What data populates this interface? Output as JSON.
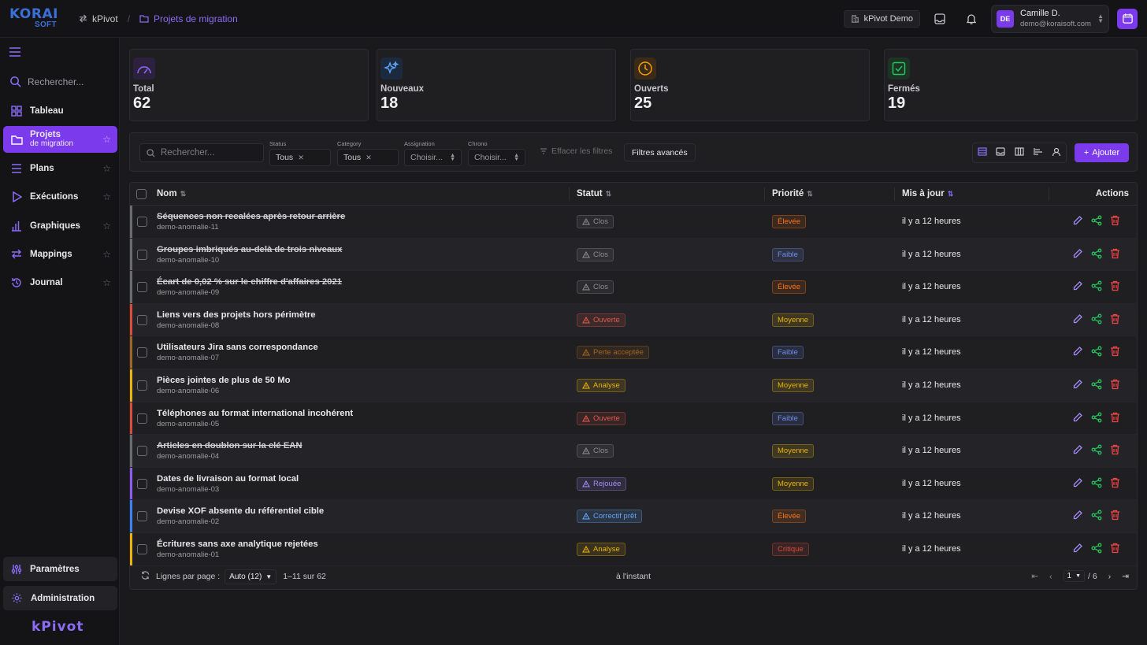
{
  "app": {
    "logo_top": "KORAI",
    "logo_bottom": "SOFT",
    "breadcrumb": [
      "kPivot",
      "Projets de migration"
    ],
    "workspace": "kPivot Demo",
    "user_initials": "DE",
    "user_name": "Camille D.",
    "user_email": "demo@koraisoft.com"
  },
  "sidebar": {
    "search_placeholder": "Rechercher...",
    "items": [
      {
        "label": "Tableau",
        "sub": "",
        "icon": "grid-icon",
        "star": false,
        "active": false
      },
      {
        "label": "Projets",
        "sub": "de migration",
        "icon": "folder-icon",
        "star": true,
        "active": true
      },
      {
        "label": "Plans",
        "sub": "",
        "icon": "list-icon",
        "star": true,
        "active": false
      },
      {
        "label": "Exécutions",
        "sub": "",
        "icon": "play-icon",
        "star": true,
        "active": false
      },
      {
        "label": "Graphiques",
        "sub": "",
        "icon": "bar-chart-icon",
        "star": true,
        "active": false
      },
      {
        "label": "Mappings",
        "sub": "",
        "icon": "arrows-icon",
        "star": true,
        "active": false
      },
      {
        "label": "Journal",
        "sub": "",
        "icon": "history-icon",
        "star": true,
        "active": false
      }
    ],
    "settings": "Paramètres",
    "admin": "Administration",
    "brand": "kPivot"
  },
  "stats": [
    {
      "label": "Total",
      "value": "62",
      "color": "#7c3aed",
      "icon": "gauge-icon"
    },
    {
      "label": "Nouveaux",
      "value": "18",
      "color": "#3b82f6",
      "icon": "sparkle-icon"
    },
    {
      "label": "Ouverts",
      "value": "25",
      "color": "#f59e0b",
      "icon": "clock-icon"
    },
    {
      "label": "Fermés",
      "value": "19",
      "color": "#22c55e",
      "icon": "check-icon"
    }
  ],
  "filters": {
    "search_placeholder": "Rechercher...",
    "status_label": "Status",
    "status_value": "Tous",
    "category_label": "Category",
    "category_value": "Tous",
    "assign_label": "Assignation",
    "assign_value": "Choisir...",
    "chrono_label": "Chrono",
    "chrono_value": "Choisir...",
    "clear": "Effacer les filtres",
    "advanced": "Filtres avancés",
    "add": "Ajouter"
  },
  "table": {
    "headers": {
      "name": "Nom",
      "status": "Statut",
      "priority": "Priorité",
      "updated": "Mis à jour",
      "actions": "Actions"
    },
    "rows": [
      {
        "name": "Séquences non recalées après retour arrière",
        "slug": "demo-anomalie-11",
        "status": "Clos",
        "priority": "Élevée",
        "updated": "il y a 12 heures",
        "struck": true,
        "bar": "#6b6b73"
      },
      {
        "name": "Groupes imbriqués au-delà de trois niveaux",
        "slug": "demo-anomalie-10",
        "status": "Clos",
        "priority": "Faible",
        "updated": "il y a 12 heures",
        "struck": true,
        "bar": "#6b6b73"
      },
      {
        "name": "Écart de 0,02 % sur le chiffre d'affaires 2021",
        "slug": "demo-anomalie-09",
        "status": "Clos",
        "priority": "Élevée",
        "updated": "il y a 12 heures",
        "struck": true,
        "bar": "#6b6b73"
      },
      {
        "name": "Liens vers des projets hors périmètre",
        "slug": "demo-anomalie-08",
        "status": "Ouverte",
        "priority": "Moyenne",
        "updated": "il y a 12 heures",
        "struck": false,
        "bar": "#dc4a3a"
      },
      {
        "name": "Utilisateurs Jira sans correspondance",
        "slug": "demo-anomalie-07",
        "status": "Perte acceptée",
        "priority": "Faible",
        "updated": "il y a 12 heures",
        "struck": false,
        "bar": "#a3661e"
      },
      {
        "name": "Pièces jointes de plus de 50 Mo",
        "slug": "demo-anomalie-06",
        "status": "Analyse",
        "priority": "Moyenne",
        "updated": "il y a 12 heures",
        "struck": false,
        "bar": "#eab308"
      },
      {
        "name": "Téléphones au format international incohérent",
        "slug": "demo-anomalie-05",
        "status": "Ouverte",
        "priority": "Faible",
        "updated": "il y a 12 heures",
        "struck": false,
        "bar": "#dc4a3a"
      },
      {
        "name": "Articles en doublon sur la clé EAN",
        "slug": "demo-anomalie-04",
        "status": "Clos",
        "priority": "Moyenne",
        "updated": "il y a 12 heures",
        "struck": true,
        "bar": "#6b6b73"
      },
      {
        "name": "Dates de livraison au format local",
        "slug": "demo-anomalie-03",
        "status": "Rejouée",
        "priority": "Moyenne",
        "updated": "il y a 12 heures",
        "struck": false,
        "bar": "#8b5cf6"
      },
      {
        "name": "Devise XOF absente du référentiel cible",
        "slug": "demo-anomalie-02",
        "status": "Correctif prêt",
        "priority": "Élevée",
        "updated": "il y a 12 heures",
        "struck": false,
        "bar": "#3b82f6"
      },
      {
        "name": "Écritures sans axe analytique rejetées",
        "slug": "demo-anomalie-01",
        "status": "Analyse",
        "priority": "Critique",
        "updated": "il y a 12 heures",
        "struck": false,
        "bar": "#eab308"
      }
    ],
    "footer": {
      "rows_per_page_label": "Lignes par page :",
      "rows_per_page_value": "Auto (12)",
      "range": "1–11 sur 62",
      "refreshed": "à l'instant",
      "page": "1",
      "of_pages": "/ 6"
    }
  },
  "colors": {
    "accent": "#7c3aed",
    "status": {
      "Clos": "#8a8a92",
      "Ouverte": "#e2574c",
      "Perte acceptée": "#a3661e",
      "Analyse": "#eab308",
      "Rejouée": "#a78bfa",
      "Correctif prêt": "#60a5fa"
    },
    "priority": {
      "Élevée": "#f97316",
      "Faible": "#6d8ff0",
      "Moyenne": "#eab308",
      "Critique": "#dc4a3a"
    }
  }
}
